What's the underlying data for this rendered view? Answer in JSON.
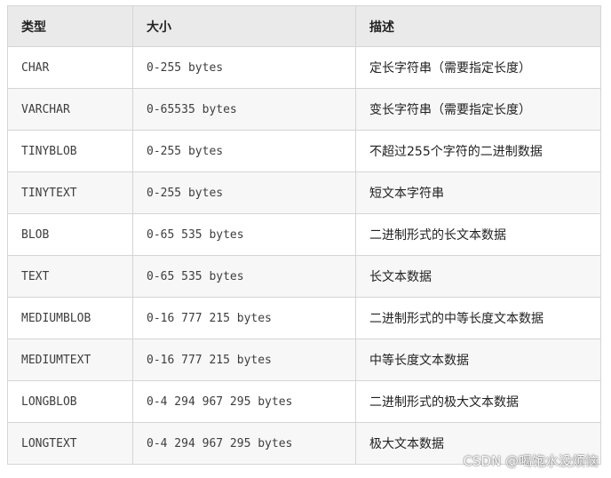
{
  "table": {
    "headers": {
      "type": "类型",
      "size": "大小",
      "description": "描述"
    },
    "rows": [
      {
        "type": "CHAR",
        "size": "0-255 bytes",
        "description": "定长字符串（需要指定长度）"
      },
      {
        "type": "VARCHAR",
        "size": "0-65535 bytes",
        "description": "变长字符串（需要指定长度）"
      },
      {
        "type": "TINYBLOB",
        "size": "0-255 bytes",
        "description": "不超过255个字符的二进制数据"
      },
      {
        "type": "TINYTEXT",
        "size": "0-255 bytes",
        "description": "短文本字符串"
      },
      {
        "type": "BLOB",
        "size": "0-65 535 bytes",
        "description": "二进制形式的长文本数据"
      },
      {
        "type": "TEXT",
        "size": "0-65 535 bytes",
        "description": "长文本数据"
      },
      {
        "type": "MEDIUMBLOB",
        "size": "0-16 777 215 bytes",
        "description": "二进制形式的中等长度文本数据"
      },
      {
        "type": "MEDIUMTEXT",
        "size": "0-16 777 215 bytes",
        "description": "中等长度文本数据"
      },
      {
        "type": "LONGBLOB",
        "size": "0-4 294 967 295 bytes",
        "description": "二进制形式的极大文本数据"
      },
      {
        "type": "LONGTEXT",
        "size": "0-4 294 967 295 bytes",
        "description": "极大文本数据"
      }
    ]
  },
  "watermark": "CSDN @喝饱水没烦恼"
}
